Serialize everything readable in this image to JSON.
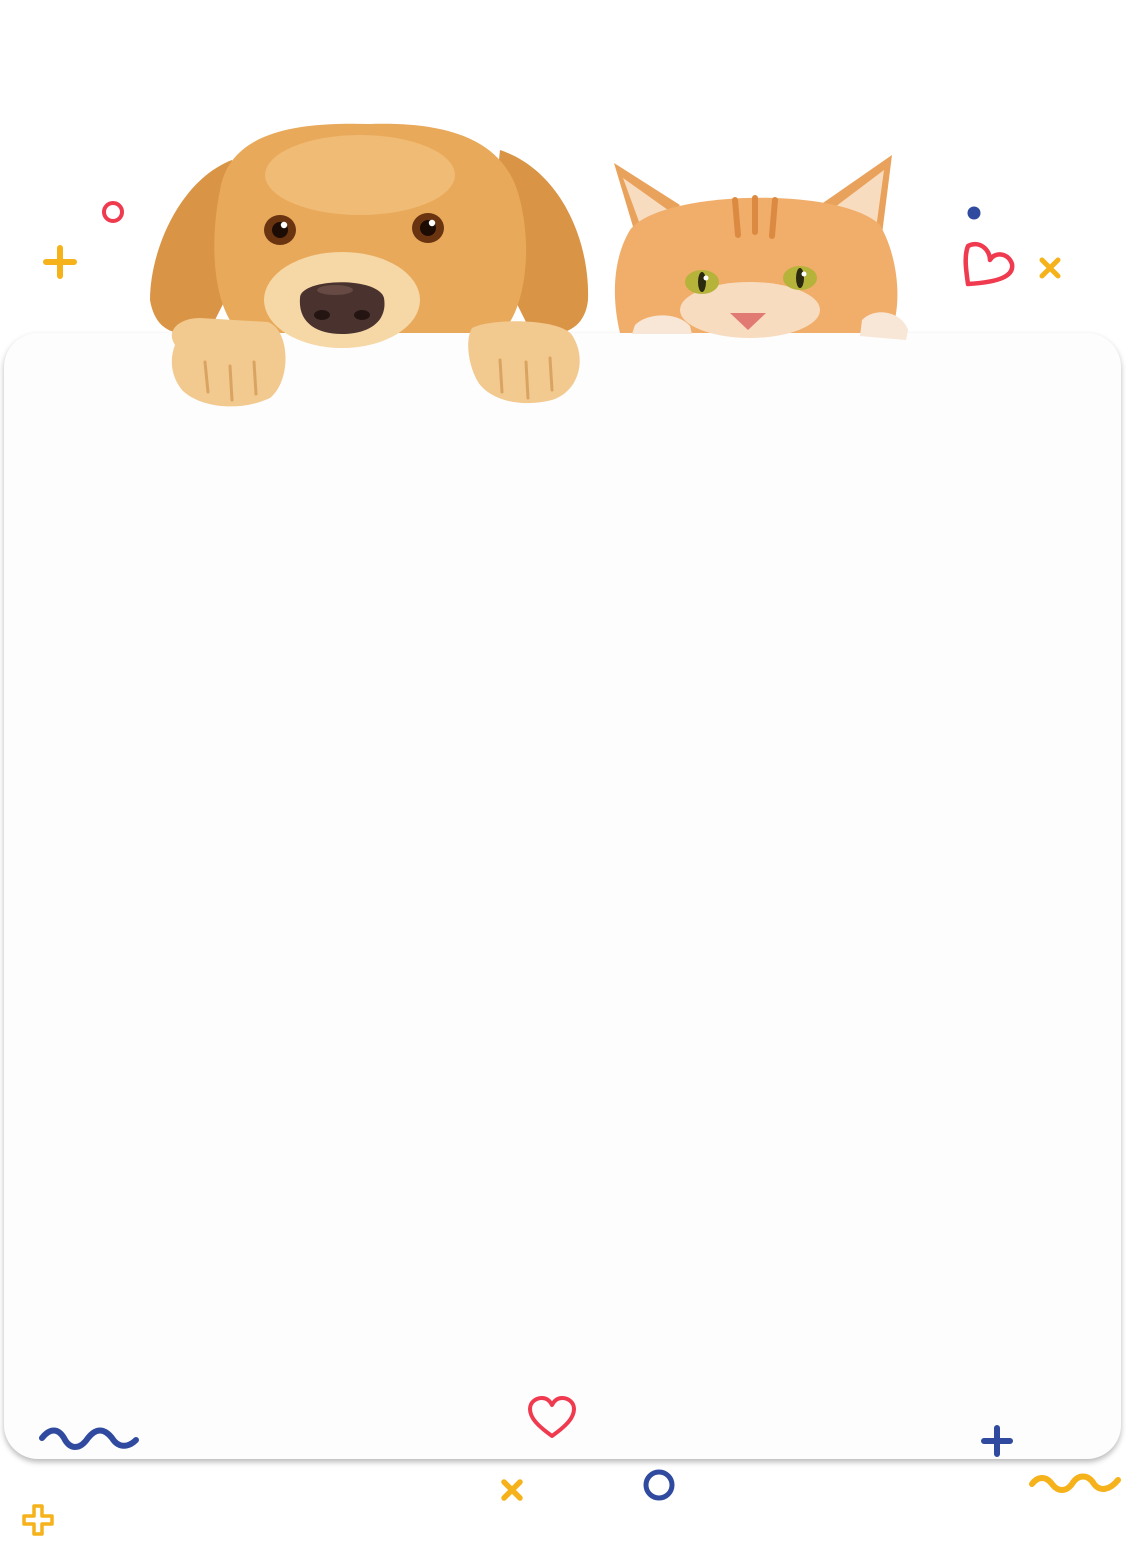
{
  "page": {
    "background": "#ffffff",
    "card_color": "#fdfdfd"
  },
  "palette": {
    "red": "#ef3a4f",
    "yellow": "#f6b21a",
    "blue": "#2f4a9e",
    "dog_fur": "#e8a95a",
    "dog_fur_dark": "#c9822f",
    "dog_fur_light": "#f6d7a6",
    "cat_fur": "#f0ae6a",
    "cat_fur_light": "#f8dcc0",
    "cat_eye": "#b5b33a"
  },
  "illustration": {
    "dog": {
      "icon": "dog-peeking"
    },
    "cat": {
      "icon": "cat-peeking"
    }
  },
  "decorations": [
    {
      "name": "ring-icon",
      "color": "red"
    },
    {
      "name": "plus-icon",
      "color": "yellow"
    },
    {
      "name": "dot-icon",
      "color": "blue"
    },
    {
      "name": "heart-outline-icon",
      "color": "red"
    },
    {
      "name": "cross-icon",
      "color": "yellow"
    },
    {
      "name": "wave-icon",
      "color": "blue"
    },
    {
      "name": "heart-outline-icon",
      "color": "red"
    },
    {
      "name": "plus-icon",
      "color": "blue"
    },
    {
      "name": "cross-icon",
      "color": "yellow"
    },
    {
      "name": "ring-icon",
      "color": "blue"
    },
    {
      "name": "wave-icon",
      "color": "yellow"
    },
    {
      "name": "plus-outline-icon",
      "color": "yellow"
    }
  ]
}
